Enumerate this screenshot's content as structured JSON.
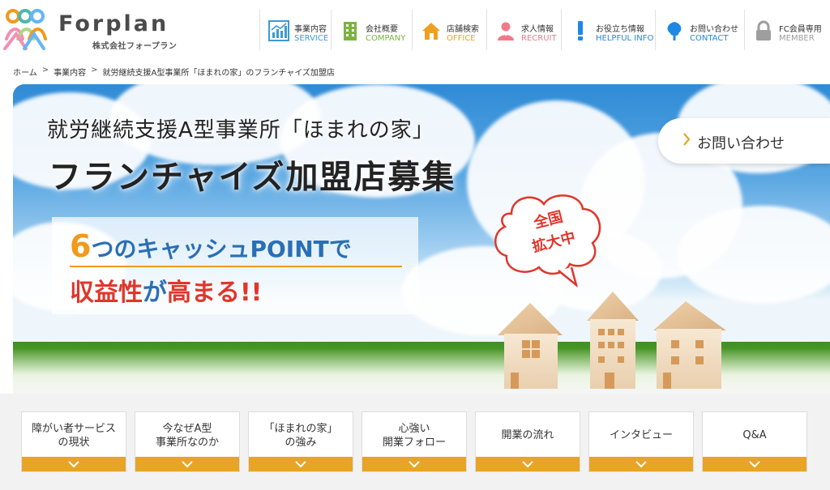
{
  "brand": {
    "name": "Forplan",
    "subtitle": "株式会社フォープラン"
  },
  "nav": [
    {
      "jp": "事業内容",
      "en": "SERVICE",
      "en_color": "#3a9bd4",
      "icon": "chart-icon"
    },
    {
      "jp": "会社概要",
      "en": "COMPANY",
      "en_color": "#7cb342",
      "icon": "building-icon"
    },
    {
      "jp": "店舗検索",
      "en": "OFFICE",
      "en_color": "#f0a020",
      "icon": "house-icon"
    },
    {
      "jp": "求人情報",
      "en": "RECRUIT",
      "en_color": "#f07a8a",
      "icon": "person-icon"
    },
    {
      "jp": "お役立ち情報",
      "en": "HELPFUL INFO",
      "en_color": "#1e88e5",
      "icon": "exclamation-icon"
    },
    {
      "jp": "お問い合わせ",
      "en": "CONTACT",
      "en_color": "#1e88e5",
      "icon": "tree-icon"
    },
    {
      "jp": "FC会員専用",
      "en": "MEMBER",
      "en_color": "#9e9e9e",
      "icon": "lock-icon"
    }
  ],
  "breadcrumb": [
    "ホーム",
    "事業内容",
    "就労継続支援A型事業所「ほまれの家」のフランチャイズ加盟店"
  ],
  "breadcrumb_sep": ">",
  "hero": {
    "line1": "就労継続支援A型事業所「ほまれの家」",
    "line2": "フランチャイズ加盟店募集",
    "contact_label": "お問い合わせ",
    "cash_num": "6",
    "cash_no": "つの",
    "cash_rest": "キャッシュPOINTで",
    "cash_l2_a": "収益性",
    "cash_l2_b": "が",
    "cash_l2_c": "高まる!!",
    "bubble_l1": "全国",
    "bubble_l2": "拡大中"
  },
  "subnav": [
    "障がい者サービス\nの現状",
    "今なぜA型\n事業所なのか",
    "「ほまれの家」\nの強み",
    "心強い\n開業フォロー",
    "開業の流れ",
    "インタビュー",
    "Q&A"
  ],
  "colors": {
    "accent_orange": "#e8a426",
    "hero_red": "#e0362b",
    "hero_blue": "#2a6fb5"
  }
}
